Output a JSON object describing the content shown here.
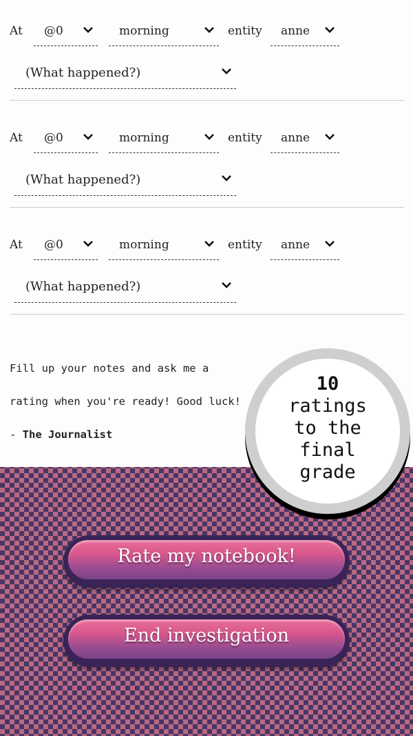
{
  "entries": [
    {
      "at_label": "At",
      "time": "@0",
      "period": "morning",
      "entity_label": "entity",
      "entity": "anne",
      "event": "(What happened?)"
    },
    {
      "at_label": "At",
      "time": "@0",
      "period": "morning",
      "entity_label": "entity",
      "entity": "anne",
      "event": "(What happened?)"
    },
    {
      "at_label": "At",
      "time": "@0",
      "period": "morning",
      "entity_label": "entity",
      "entity": "anne",
      "event": "(What happened?)"
    }
  ],
  "notes": {
    "text": "Fill up your notes and ask me a rating when you're ready! Good luck! - ",
    "signature": "The Journalist"
  },
  "badge": {
    "count": "10",
    "line1": "ratings",
    "line2": "to the",
    "line3": "final",
    "line4": "grade"
  },
  "buttons": {
    "rate": "Rate my notebook!",
    "end": "End investigation"
  },
  "colors": {
    "button_top": "#e8709a",
    "button_bottom": "#7a4288",
    "button_border": "#3a2356",
    "pattern_light": "#b76a82",
    "pattern_dark": "#4a3566"
  },
  "icons": {
    "dropdown": "chevron-down-icon"
  }
}
